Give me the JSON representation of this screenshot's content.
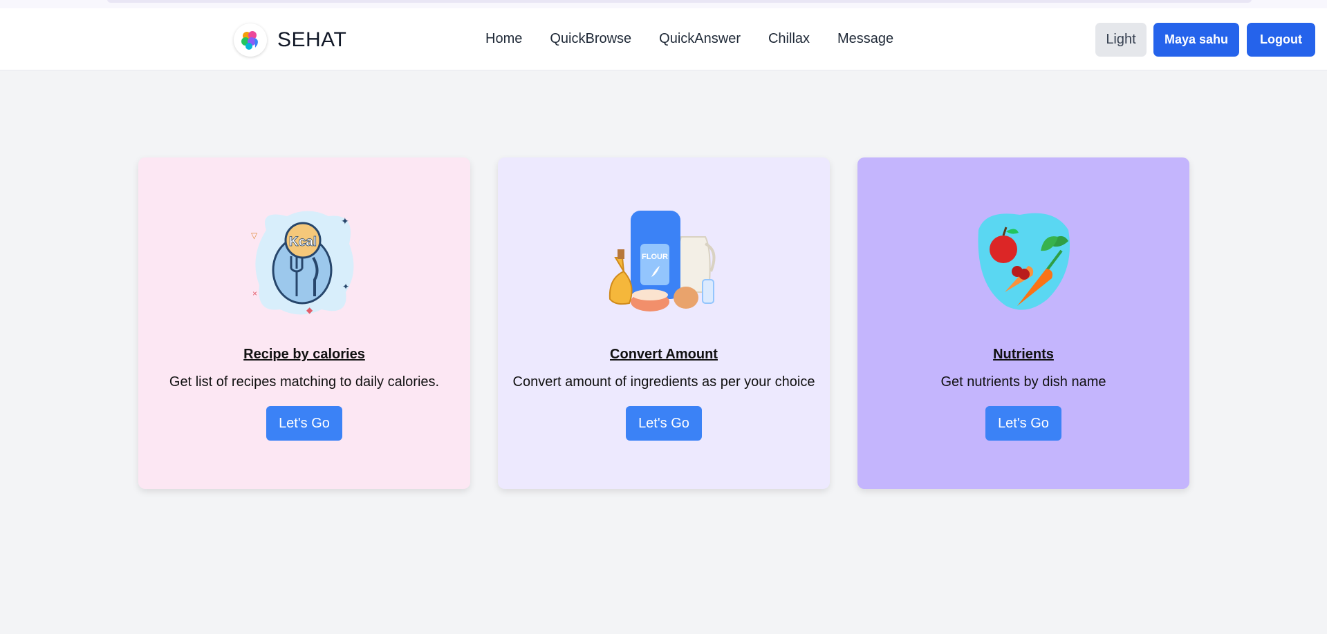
{
  "app": {
    "brand": "SEHAT"
  },
  "nav": {
    "links": [
      "Home",
      "QuickBrowse",
      "QuickAnswer",
      "Chillax",
      "Message"
    ]
  },
  "header_actions": {
    "theme_toggle": "Light",
    "user_button": "Maya sahu",
    "logout_button": "Logout"
  },
  "cards": [
    {
      "title": "Recipe by calories",
      "description": "Get list of recipes matching to daily calories.",
      "button": "Let's Go",
      "illustration_text": "Kcal",
      "bg": "#fce7f3"
    },
    {
      "title": "Convert Amount",
      "description": "Convert amount of ingredients as per your choice",
      "button": "Let's Go",
      "illustration_text": "FLOUR",
      "bg": "#ede9fe"
    },
    {
      "title": "Nutrients",
      "description": "Get nutrients by dish name",
      "button": "Let's Go",
      "bg": "#c4b5fd"
    }
  ],
  "colors": {
    "primary": "#2563eb",
    "card_button": "#3b82f6",
    "page_bg": "#f3f4f6"
  }
}
